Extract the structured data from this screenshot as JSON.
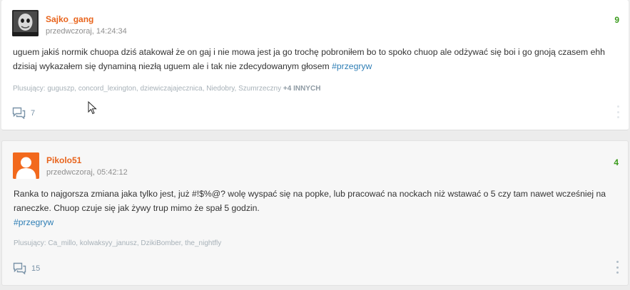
{
  "posts": [
    {
      "author": "Sajko_gang",
      "date": "przedwczoraj, 14:24:34",
      "score": "9",
      "body": "uguem jakiś normik chuopa dziś atakował że on gaj i nie mowa jest ja go trochę pobroniłem bo to spoko chuop ale odżywać się boi i go gnoją czasem ehh dzisiaj wykazałem się dynaminą niezłą uguem ale i tak nie zdecydowanym głosem ",
      "tag": "#przegryw",
      "plus_label": "Plusujący:",
      "plus_users": "guguszp, concord_lexington, dziewiczajajecznica, Niedobry, Szumrzeczny",
      "plus_more": "+4 INNYCH",
      "comments": "7"
    },
    {
      "author": "Pikolo51",
      "date": "przedwczoraj, 05:42:12",
      "score": "4",
      "body": "Ranka to najgorsza zmiana jaka tylko jest, już #!$%@? wolę wyspać się na popke, lub pracować na nockach niż wstawać o 5 czy tam nawet wcześniej na raneczke. Chuop czuje się jak żywy trup mimo że spał 5 godzin.",
      "tag": "#przegryw",
      "plus_label": "Plusujący:",
      "plus_users": "Ca_millo, kolwaksyy_janusz, DzikiBomber, the_nightfly",
      "comments": "15"
    }
  ],
  "icons": {
    "comment": "comment-icon",
    "menu": "more-vertical-icon",
    "avatar_default": "user-silhouette-icon",
    "cursor": "mouse-cursor-icon"
  },
  "colors": {
    "author": "#e8641c",
    "score": "#3b9c1d",
    "tag": "#2e7eb5",
    "meta": "#a7b1b8",
    "avatar_default_bg": "#f2691d"
  }
}
